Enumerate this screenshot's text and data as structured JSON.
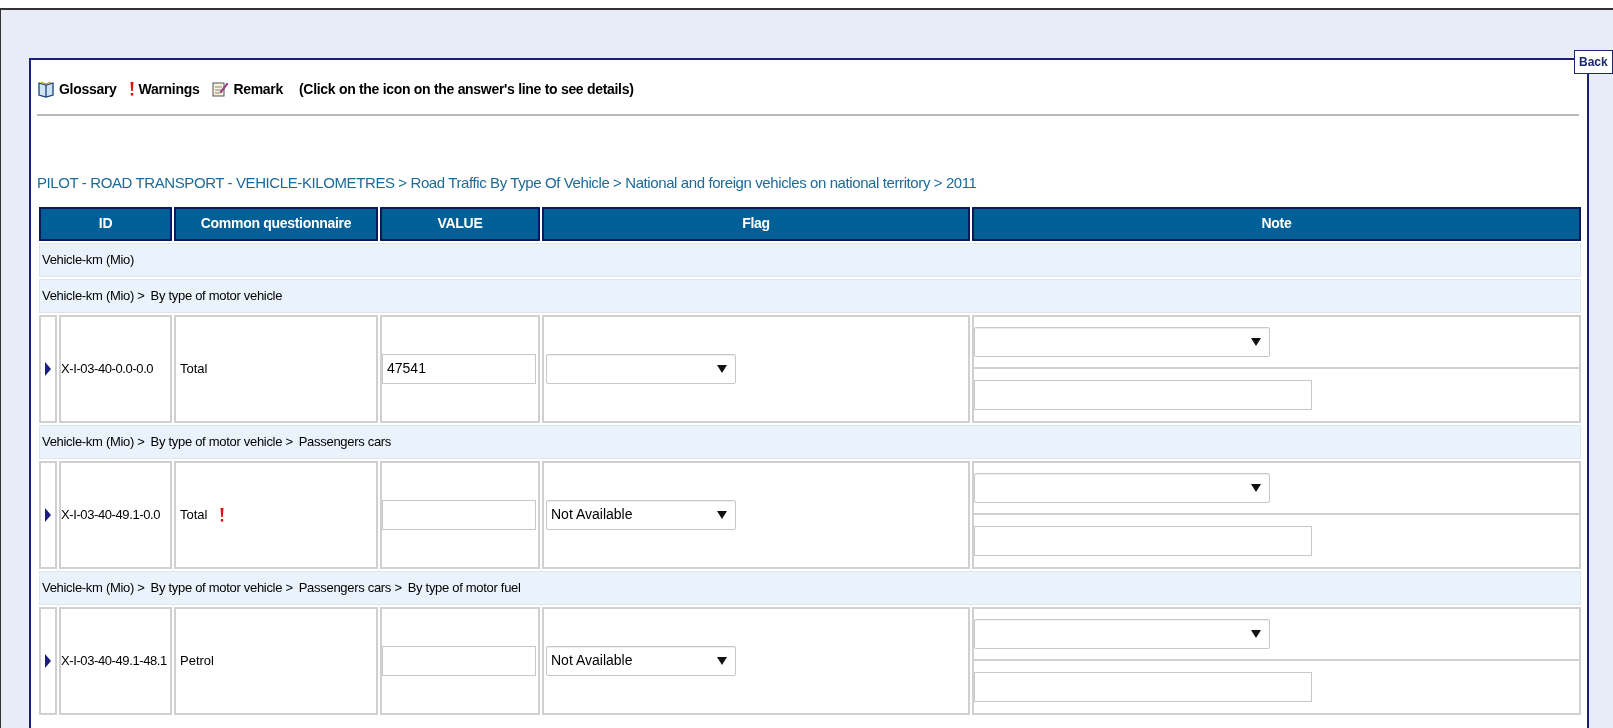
{
  "back_button": {
    "label": "Back"
  },
  "legend": {
    "items": [
      {
        "kind": "glossary",
        "label": "Glossary"
      },
      {
        "kind": "warning",
        "label": "Warnings"
      },
      {
        "kind": "remark",
        "label": "Remark"
      }
    ],
    "hint": "(Click on the icon on the answer's line to see details)"
  },
  "breadcrumb": "PILOT - ROAD TRANSPORT - VEHICLE-KILOMETRES > Road Traffic By Type Of Vehicle > National and foreign vehicles on national territory > 2011",
  "table": {
    "columns": [
      "ID",
      "Common questionnaire",
      "VALUE",
      "Flag",
      "Note"
    ],
    "rows": [
      {
        "kind": "group",
        "path": [
          "Vehicle-km (Mio)"
        ]
      },
      {
        "kind": "group",
        "path": [
          "Vehicle-km (Mio) >",
          "By type of motor vehicle"
        ]
      },
      {
        "kind": "item",
        "id": "X-I-03-40-0.0-0.0",
        "label": "Total",
        "warning": false,
        "value": "47541"
      },
      {
        "kind": "group",
        "path": [
          "Vehicle-km (Mio) >",
          "By type of motor vehicle >",
          "Passengers cars"
        ]
      },
      {
        "kind": "item",
        "id": "X-I-03-40-49.1-0.0",
        "label": "Total",
        "warning": true,
        "flag": "Not Available"
      },
      {
        "kind": "group",
        "path": [
          "Vehicle-km (Mio) >",
          "By type of motor vehicle >",
          "Passengers cars >",
          "By type of motor fuel"
        ]
      },
      {
        "kind": "item",
        "id": "X-I-03-40-49.1-48.1",
        "label": "Petrol",
        "warning": false,
        "flag": "Not Available"
      }
    ]
  }
}
